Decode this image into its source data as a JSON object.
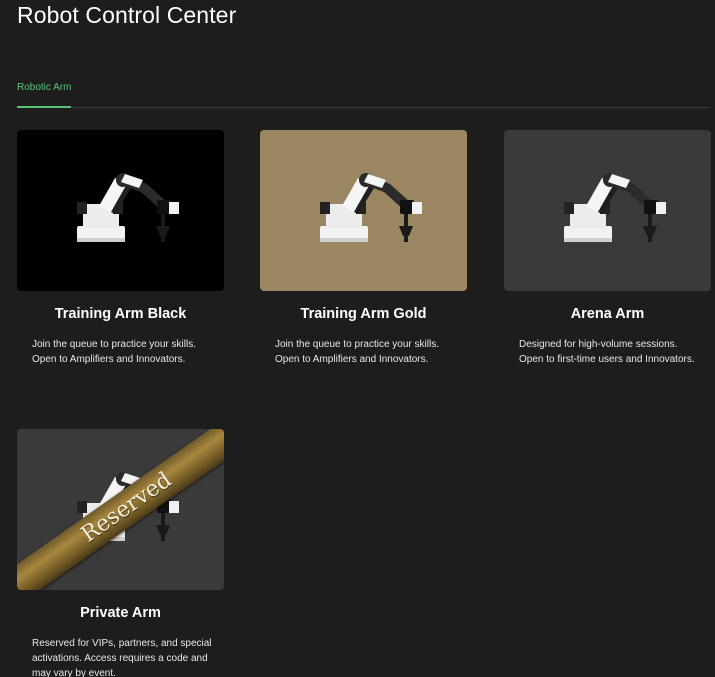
{
  "page": {
    "title": "Robot Control Center"
  },
  "tabs": [
    {
      "label": "Robotic Arm",
      "active": true
    }
  ],
  "colors": {
    "background": "#1d1d1d",
    "accent": "#58c47a"
  },
  "cards": [
    {
      "title": "Training Arm Black",
      "description": "Join the queue to practice your skills. Open to Amplifiers and Innovators.",
      "image_bg": "#000000",
      "icon": "robotic-arm-icon"
    },
    {
      "title": "Training Arm Gold",
      "description": "Join the queue to practice your skills. Open to Amplifiers and Innovators.",
      "image_bg": "#9a8660",
      "icon": "robotic-arm-icon"
    },
    {
      "title": "Arena Arm",
      "description": "Designed for high-volume sessions. Open to first-time users and Innovators.",
      "image_bg": "#3a3a3a",
      "icon": "robotic-arm-icon"
    },
    {
      "title": "Private Arm",
      "description": "Reserved for VIPs, partners, and special activations. Access requires a code and may vary by event.",
      "image_bg": "#3a3a3a",
      "icon": "robotic-arm-icon",
      "banner": "Reserved"
    }
  ]
}
